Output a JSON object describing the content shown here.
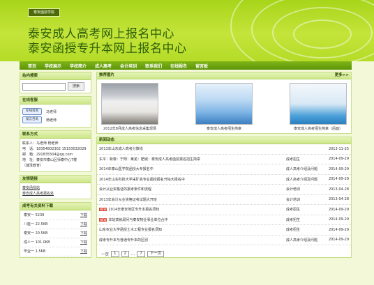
{
  "banner": {
    "logo": "泰安函授学院",
    "title1": "泰安成人高考网上报名中心",
    "title2": "泰安函授专升本网上报名中心"
  },
  "nav": [
    "首页",
    "学校展示",
    "学校简介",
    "成人高考",
    "会计培训",
    "联系我们",
    "在线报名",
    "留言板"
  ],
  "search": {
    "title": "站内搜索",
    "button": "搜索",
    "placeholder": ""
  },
  "service": {
    "title": "在线客服",
    "items": [
      {
        "btn": "在线咨询",
        "name": "马老师"
      },
      {
        "btn": "留言咨询",
        "name": "杨老师"
      }
    ]
  },
  "contact": {
    "title": "联系方式",
    "lines": [
      "联系人：马老师 杨老师",
      "电　话：18354802302 15153032029",
      "邮　箱：291835504@qq.com",
      "地　址：泰安市泰山区师泰中心7楼",
      "（潍泽教育）"
    ]
  },
  "links": {
    "title": "友情链接",
    "items": [
      "泰安函授站",
      "泰安成人高考报名处"
    ]
  },
  "downloads": {
    "title": "成考有关资料下载",
    "items": [
      {
        "name": "泰安一 5239",
        "action": "下载"
      },
      {
        "name": "八座一 22.5KB",
        "action": "下载"
      },
      {
        "name": "泰安一 20.5KB",
        "action": "下载"
      },
      {
        "name": "成人一 101.0KB",
        "action": "下载"
      },
      {
        "name": "毕业一 1.5KB",
        "action": "下载"
      }
    ]
  },
  "pictures": {
    "title": "推荐图片",
    "more": "更多>>",
    "items": [
      {
        "caption": "2012年8月成人高考信息采集现场"
      },
      {
        "caption": "泰安成人高考招生简章"
      },
      {
        "caption": "泰安成人高考招生简章（后面）"
      }
    ]
  },
  "news": {
    "title": "新闻动态",
    "rows": [
      {
        "hot": false,
        "title": "2013年山东成人高考分数线",
        "cat": "",
        "date": "2013-11-25"
      },
      {
        "hot": false,
        "title": "东平：新泰：宁阳：莱芜：肥城：泰安成人高考函授报名招生简章",
        "cat": "成考招生",
        "date": "2014-09-29"
      },
      {
        "hot": false,
        "title": "2014年泰山医学院函授大专报名中",
        "cat": "成人高考介绍及问题",
        "date": "2014-09-29"
      },
      {
        "hot": false,
        "title": "2014年山东科技大学采矿高专业函授报名开始大报名中",
        "cat": "成人高考介绍及问题",
        "date": "2014-09-29"
      },
      {
        "hot": false,
        "title": "会计从业资格证的报考条件和流程",
        "cat": "会计培训",
        "date": "2013-04-28"
      },
      {
        "hot": false,
        "title": "2013年会计从业资格证考试题大开班",
        "cat": "会计培训",
        "date": "2013-04-28"
      },
      {
        "hot": true,
        "title": "2014年泰安地区专升本报名须知",
        "cat": "成考招生",
        "date": "2014-09-29"
      },
      {
        "hot": true,
        "title": "本站高就顾问与泰安物业事业单位合作",
        "cat": "成考招生",
        "date": "2014-09-29"
      },
      {
        "hot": false,
        "title": "山东农业大学函授土木工程专业报名须知",
        "cat": "成考招生",
        "date": "2014-09-29"
      },
      {
        "hot": false,
        "title": "成考专升本与普通专升本的区别",
        "cat": "成人高考介绍及问题",
        "date": "2014-09-29"
      }
    ]
  },
  "pager": {
    "first": "一页",
    "p1": "1",
    "p2": "2",
    "dots": "...",
    "p7": "7",
    "next": "下一页"
  },
  "colors": {
    "accent": "#7fb516",
    "title": "#2d5f0a"
  }
}
